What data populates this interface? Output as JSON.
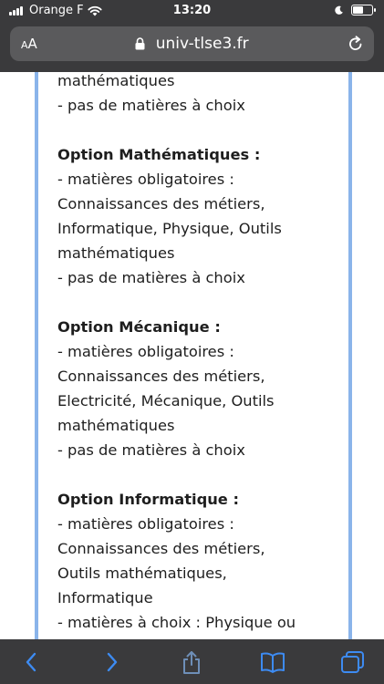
{
  "status_bar": {
    "carrier": "Orange F",
    "time": "13:20"
  },
  "browser": {
    "aa_label_small": "A",
    "aa_label_big": "A",
    "url": "univ-tlse3.fr"
  },
  "content": {
    "lines": [
      {
        "text": "mathématiques",
        "style": "normal"
      },
      {
        "text": "- pas de matières à choix",
        "style": "normal"
      },
      {
        "text": "",
        "style": "gap"
      },
      {
        "text": "Option Mathématiques :",
        "style": "heading"
      },
      {
        "text": "- matières obligatoires :",
        "style": "normal"
      },
      {
        "text": "Connaissances des métiers,",
        "style": "normal"
      },
      {
        "text": "Informatique, Physique, Outils",
        "style": "normal"
      },
      {
        "text": "mathématiques",
        "style": "normal"
      },
      {
        "text": "- pas de matières à choix",
        "style": "normal"
      },
      {
        "text": "",
        "style": "gap"
      },
      {
        "text": "Option Mécanique :",
        "style": "heading"
      },
      {
        "text": "- matières obligatoires :",
        "style": "normal"
      },
      {
        "text": "Connaissances des métiers,",
        "style": "normal"
      },
      {
        "text": "Electricité, Mécanique, Outils",
        "style": "normal"
      },
      {
        "text": "mathématiques",
        "style": "normal"
      },
      {
        "text": "- pas de matières à choix",
        "style": "normal"
      },
      {
        "text": "",
        "style": "gap"
      },
      {
        "text": "Option Informatique :",
        "style": "heading"
      },
      {
        "text": "- matières obligatoires :",
        "style": "normal"
      },
      {
        "text": "Connaissances des métiers,",
        "style": "normal"
      },
      {
        "text": "Outils mathématiques,",
        "style": "normal"
      },
      {
        "text": "Informatique",
        "style": "normal"
      },
      {
        "text": "- matières à choix : Physique ou",
        "style": "normal"
      }
    ]
  },
  "toolbar": {
    "items": [
      "back-icon",
      "forward-icon",
      "share-icon",
      "bookmarks-icon",
      "tabs-icon"
    ],
    "accent": "#3d8bf2",
    "disabled": "#6e8fb8"
  },
  "colors": {
    "chrome": "#3a3a3c",
    "url_bar": "#5a5a5c",
    "frame_border": "#8ab4ea"
  }
}
